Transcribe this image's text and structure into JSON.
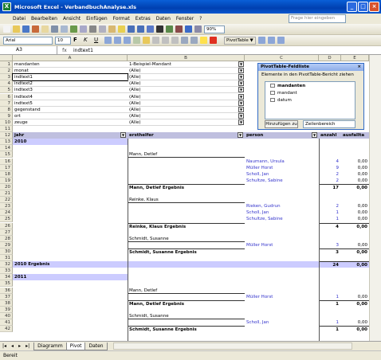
{
  "window": {
    "title": "Microsoft Excel - VerbandbuchAnalyse.xls",
    "app_icon": "X"
  },
  "menu": [
    "Datei",
    "Bearbeiten",
    "Ansicht",
    "Einfügen",
    "Format",
    "Extras",
    "Daten",
    "Fenster",
    "?"
  ],
  "help_placeholder": "Frage hier eingeben",
  "toolbar": {
    "font": "Arial",
    "size": "10",
    "zoom": "90%",
    "pivot": "PivotTable ▼"
  },
  "formula": {
    "namebox": "A3",
    "fx": "fx",
    "content": "indtext1"
  },
  "columns": [
    "A",
    "B",
    "C",
    "D",
    "E"
  ],
  "page_fields": [
    {
      "row": "1",
      "name": "mandanten",
      "value": "1-Beispiel-Mandant"
    },
    {
      "row": "2",
      "name": "monat",
      "value": "(Alle)"
    },
    {
      "row": "3",
      "name": "indtext1",
      "value": "(Alle)"
    },
    {
      "row": "4",
      "name": "indtext2",
      "value": "(Alle)"
    },
    {
      "row": "5",
      "name": "indtext3",
      "value": "(Alle)"
    },
    {
      "row": "6",
      "name": "indtext4",
      "value": "(Alle)"
    },
    {
      "row": "7",
      "name": "indtext5",
      "value": "(Alle)"
    },
    {
      "row": "8",
      "name": "gegenstand",
      "value": "(Alle)"
    },
    {
      "row": "9",
      "name": "ort",
      "value": "(Alle)"
    },
    {
      "row": "10",
      "name": "zeuge",
      "value": "(Alle)"
    }
  ],
  "row11": "11",
  "header": {
    "row": "12",
    "jahr": "jahr",
    "ersthelfer": "ersthelfer",
    "person": "person",
    "anzahl": "anzahl",
    "ausfallta": "ausfallta"
  },
  "body": [
    {
      "r": "13",
      "a": "2010",
      "b": "",
      "c": "",
      "d": "",
      "e": "",
      "type": "year"
    },
    {
      "r": "14",
      "a": "",
      "b": "",
      "c": "",
      "d": "",
      "e": ""
    },
    {
      "r": "15",
      "a": "",
      "b": "Mann, Detlef",
      "c": "",
      "d": "",
      "e": ""
    },
    {
      "r": "16",
      "a": "",
      "b": "",
      "c": "Naumann, Ursula",
      "d": "4",
      "e": "0,00"
    },
    {
      "r": "17",
      "a": "",
      "b": "",
      "c": "Müller Horst",
      "d": "9",
      "e": "0,00"
    },
    {
      "r": "18",
      "a": "",
      "b": "",
      "c": "Scholl, Jan",
      "d": "2",
      "e": "0,00"
    },
    {
      "r": "19",
      "a": "",
      "b": "",
      "c": "Schultze, Sabine",
      "d": "2",
      "e": "0,00"
    },
    {
      "r": "20",
      "a": "",
      "b": "Mann, Detlef Ergebnis",
      "c": "",
      "d": "17",
      "e": "0,00",
      "type": "sub"
    },
    {
      "r": "21",
      "a": "",
      "b": "",
      "c": "",
      "d": "",
      "e": ""
    },
    {
      "r": "22",
      "a": "",
      "b": "Reinke, Klaus",
      "c": "",
      "d": "",
      "e": ""
    },
    {
      "r": "23",
      "a": "",
      "b": "",
      "c": "Rieken, Gudrun",
      "d": "2",
      "e": "0,00"
    },
    {
      "r": "24",
      "a": "",
      "b": "",
      "c": "Scholl, Jan",
      "d": "1",
      "e": "0,00"
    },
    {
      "r": "25",
      "a": "",
      "b": "",
      "c": "Schultze, Sabine",
      "d": "1",
      "e": "0,00"
    },
    {
      "r": "26",
      "a": "",
      "b": "Reinke, Klaus Ergebnis",
      "c": "",
      "d": "4",
      "e": "0,00",
      "type": "sub"
    },
    {
      "r": "27",
      "a": "",
      "b": "",
      "c": "",
      "d": "",
      "e": ""
    },
    {
      "r": "28",
      "a": "",
      "b": "Schmidt, Susanne",
      "c": "",
      "d": "",
      "e": ""
    },
    {
      "r": "29",
      "a": "",
      "b": "",
      "c": "Müller Horst",
      "d": "3",
      "e": "0,00"
    },
    {
      "r": "30",
      "a": "",
      "b": "Schmidt, Susanne Ergebnis",
      "c": "",
      "d": "3",
      "e": "0,00",
      "type": "sub"
    },
    {
      "r": "31",
      "a": "",
      "b": "",
      "c": "",
      "d": "",
      "e": ""
    },
    {
      "r": "32",
      "a": "2010 Ergebnis",
      "b": "",
      "c": "",
      "d": "24",
      "e": "0,00",
      "type": "total"
    },
    {
      "r": "33",
      "a": "",
      "b": "",
      "c": "",
      "d": "",
      "e": ""
    },
    {
      "r": "34",
      "a": "2011",
      "b": "",
      "c": "",
      "d": "",
      "e": "",
      "type": "year"
    },
    {
      "r": "35",
      "a": "",
      "b": "",
      "c": "",
      "d": "",
      "e": ""
    },
    {
      "r": "36",
      "a": "",
      "b": "Mann, Detlef",
      "c": "",
      "d": "",
      "e": ""
    },
    {
      "r": "37",
      "a": "",
      "b": "",
      "c": "Müller Horst",
      "d": "1",
      "e": "0,00"
    },
    {
      "r": "38",
      "a": "",
      "b": "Mann, Detlef Ergebnis",
      "c": "",
      "d": "1",
      "e": "0,00",
      "type": "sub"
    },
    {
      "r": "39",
      "a": "",
      "b": "",
      "c": "",
      "d": "",
      "e": ""
    },
    {
      "r": "40",
      "a": "",
      "b": "Schmidt, Susanne",
      "c": "",
      "d": "",
      "e": ""
    },
    {
      "r": "41",
      "a": "",
      "b": "",
      "c": "Scholl, Jan",
      "d": "1",
      "e": "0,00"
    },
    {
      "r": "42",
      "a": "",
      "b": "Schmidt, Susanne Ergebnis",
      "c": "",
      "d": "1",
      "e": "0,00",
      "type": "sub"
    }
  ],
  "fieldlist": {
    "title": "PivotTable-Feldliste",
    "hint": "Elemente in den PivotTable-Bericht ziehen",
    "items": [
      "mandanten",
      "mandant",
      "datum"
    ],
    "button": "Hinzufügen zu",
    "target": "Zeilenbereich"
  },
  "sheets": [
    "Diagramm",
    "Pivot",
    "Daten"
  ],
  "active_sheet": "Pivot",
  "status": "Bereit",
  "colors": {
    "year_fill": "#CCCCFF",
    "blue_text": "#3333CC",
    "title_bar": "#0A5FD8"
  }
}
